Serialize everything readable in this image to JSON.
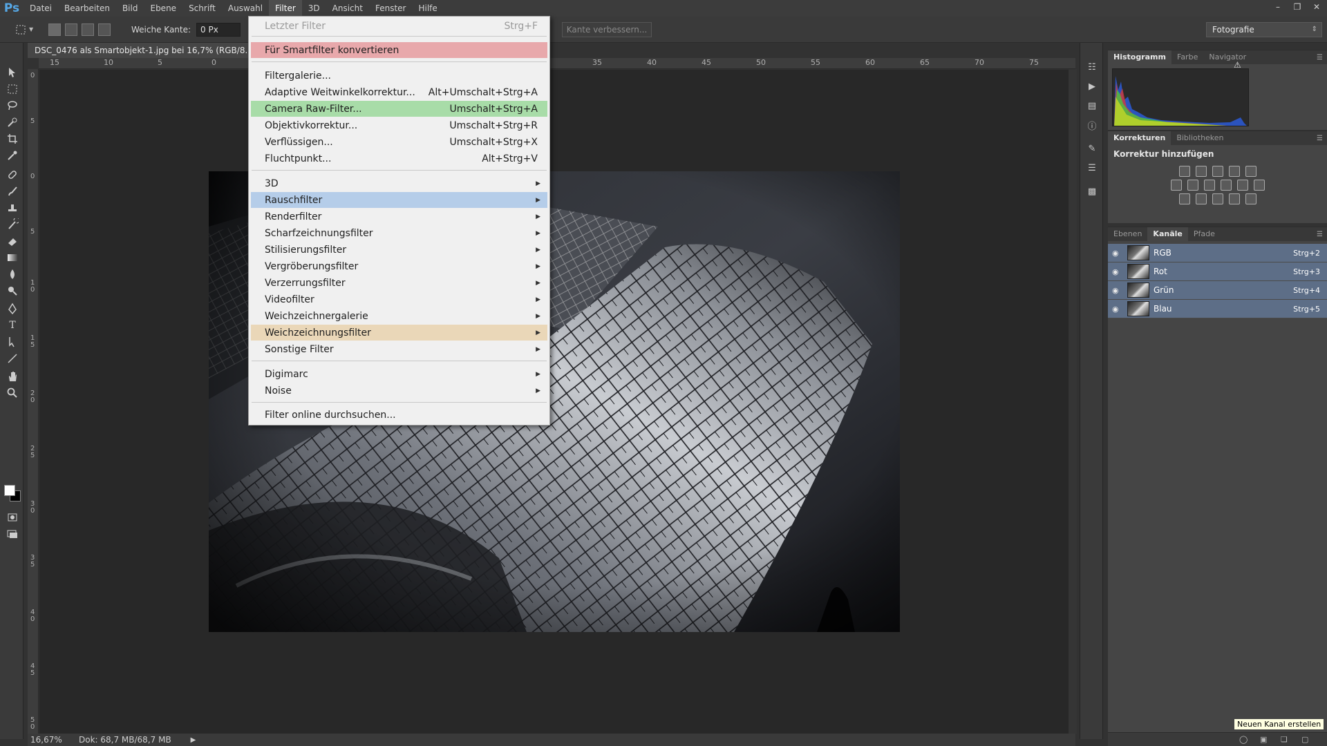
{
  "menubar": {
    "logo": "Ps",
    "items": [
      "Datei",
      "Bearbeiten",
      "Bild",
      "Ebene",
      "Schrift",
      "Auswahl",
      "Filter",
      "3D",
      "Ansicht",
      "Fenster",
      "Hilfe"
    ],
    "active": "Filter"
  },
  "options": {
    "feather_label": "Weiche Kante:",
    "feather_value": "0 Px",
    "refine_edge": "Kante verbessern...",
    "workspace": "Fotografie"
  },
  "document": {
    "tab_title": "DSC_0476 als Smartobjekt-1.jpg bei 16,7% (RGB/8...",
    "ruler_top": [
      "15",
      "10",
      "5",
      "0",
      "35",
      "40",
      "45",
      "50",
      "55",
      "60",
      "65",
      "70",
      "75"
    ],
    "ruler_left": [
      "0",
      "5",
      "0",
      "5",
      "1 0",
      "1 5",
      "2 0",
      "2 5",
      "3 0",
      "3 5",
      "4 0",
      "4 5",
      "5 0"
    ]
  },
  "status": {
    "zoom": "16,67%",
    "doc_size": "Dok: 68,7 MB/68,7 MB"
  },
  "panels": {
    "top_tabs": [
      "Histogramm",
      "Farbe",
      "Navigator"
    ],
    "corr_tabs": [
      "Korrekturen",
      "Bibliotheken"
    ],
    "corr_title": "Korrektur hinzufügen",
    "layer_tabs": [
      "Ebenen",
      "Kanäle",
      "Pfade"
    ],
    "channels": [
      {
        "name": "RGB",
        "key": "Strg+2"
      },
      {
        "name": "Rot",
        "key": "Strg+3"
      },
      {
        "name": "Grün",
        "key": "Strg+4"
      },
      {
        "name": "Blau",
        "key": "Strg+5"
      }
    ],
    "tooltip": "Neuen Kanal erstellen"
  },
  "filter_menu": {
    "last_filter": {
      "label": "Letzter Filter",
      "key": "Strg+F"
    },
    "smart": "Für Smartfilter konvertieren",
    "group1": [
      {
        "label": "Filtergalerie...",
        "key": ""
      },
      {
        "label": "Adaptive Weitwinkelkorrektur...",
        "key": "Alt+Umschalt+Strg+A"
      },
      {
        "label": "Camera Raw-Filter...",
        "key": "Umschalt+Strg+A"
      },
      {
        "label": "Objektivkorrektur...",
        "key": "Umschalt+Strg+R"
      },
      {
        "label": "Verflüssigen...",
        "key": "Umschalt+Strg+X"
      },
      {
        "label": "Fluchtpunkt...",
        "key": "Alt+Strg+V"
      }
    ],
    "group2": [
      "3D",
      "Rauschfilter",
      "Renderfilter",
      "Scharfzeichnungsfilter",
      "Stilisierungsfilter",
      "Vergröberungsfilter",
      "Verzerrungsfilter",
      "Videofilter",
      "Weichzeichnergalerie",
      "Weichzeichnungsfilter",
      "Sonstige Filter"
    ],
    "group3": [
      "Digimarc",
      "Noise"
    ],
    "search": "Filter online durchsuchen..."
  }
}
